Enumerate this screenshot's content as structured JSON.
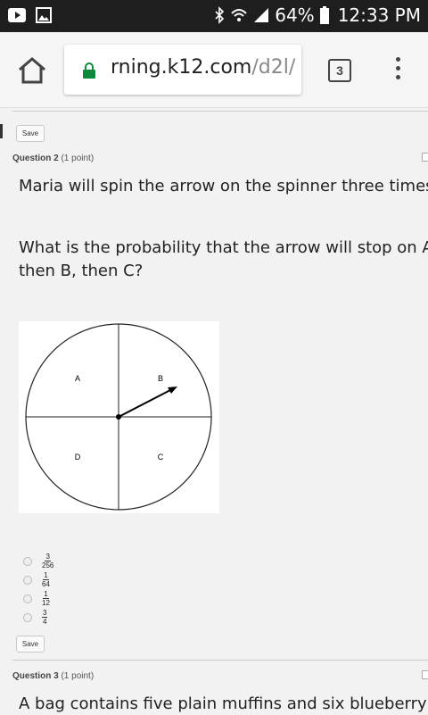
{
  "status_bar": {
    "battery_percent": "64%",
    "time": "12:33 PM",
    "icons": [
      "youtube-icon",
      "image-icon",
      "bluetooth-icon",
      "wifi-icon",
      "signal-icon",
      "battery-icon"
    ]
  },
  "browser": {
    "url_host": "rning.k12.com",
    "url_path": "/d2l/",
    "tab_count": "3"
  },
  "questions": [
    {
      "save_label": "Save"
    },
    {
      "label": "Question 2",
      "points": "(1 point)",
      "text_line1": "Maria will spin the arrow on the spinner three times.",
      "text_line2": "What is the probability that the arrow will stop on A,",
      "text_line3": "then B, then C?",
      "spinner_sections": [
        "A",
        "B",
        "D",
        "C"
      ],
      "options": [
        {
          "num": "3",
          "den": "256"
        },
        {
          "num": "1",
          "den": "64"
        },
        {
          "num": "1",
          "den": "12"
        },
        {
          "num": "3",
          "den": "4"
        }
      ],
      "save_label": "Save"
    },
    {
      "label": "Question 3",
      "points": "(1 point)",
      "text_line1": "A bag contains five plain muffins and six blueberry"
    }
  ]
}
